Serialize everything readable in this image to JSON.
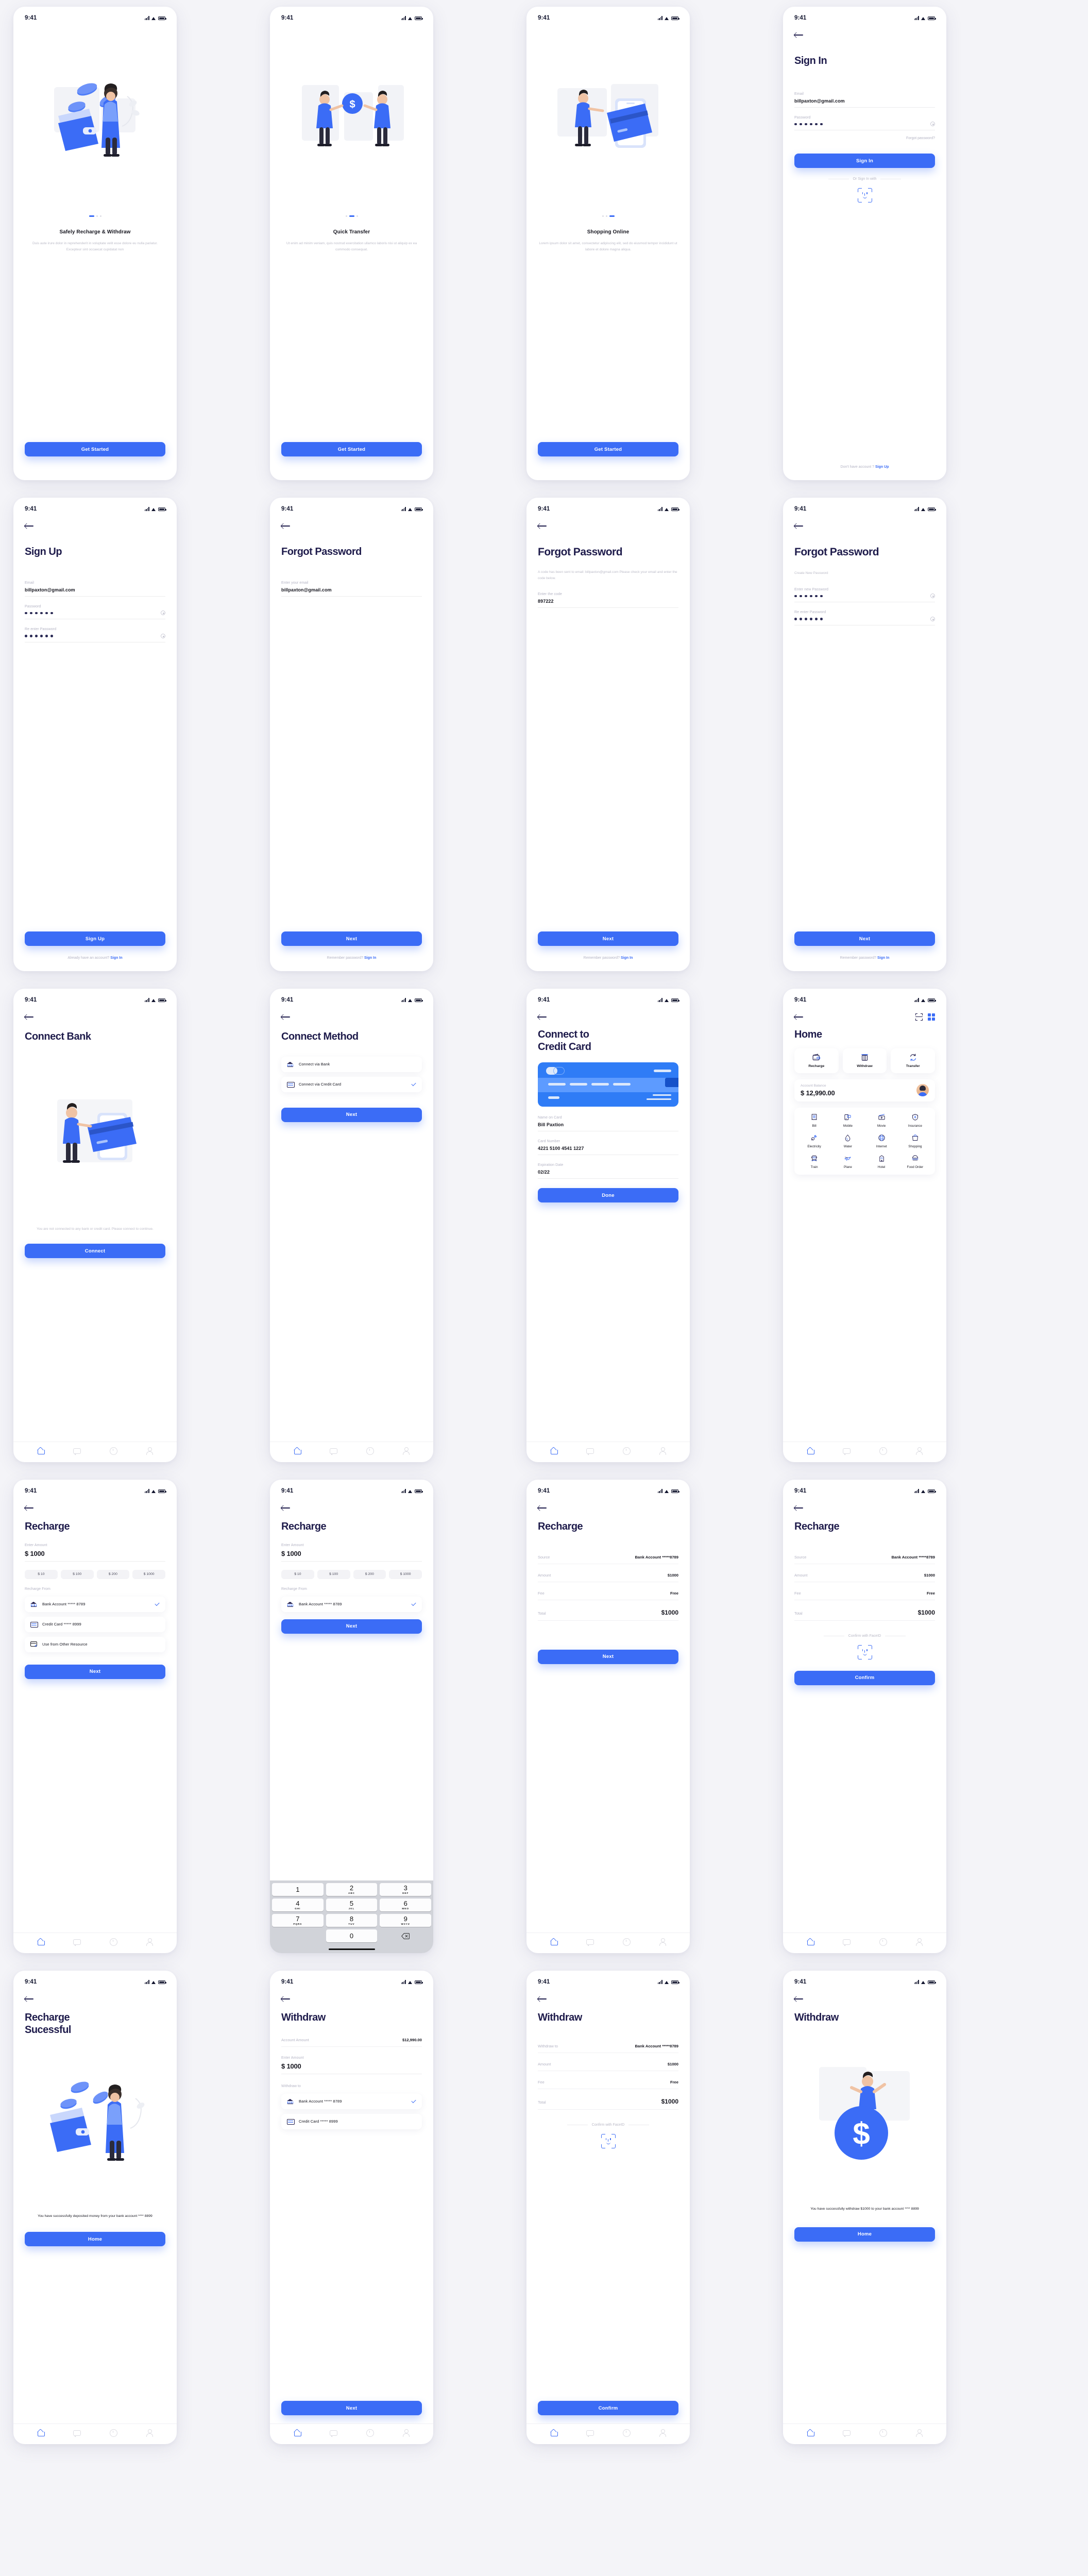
{
  "status_bar": {
    "time": "9:41"
  },
  "colors": {
    "primary": "#3b6cf6",
    "ink": "#1e1b4b",
    "muted": "#b4b4c4",
    "bg": "#f4f4f8"
  },
  "screens": {
    "onboard1": {
      "title": "Safely Recharge & Withdraw",
      "desc": "Duis aute irure dolor in reprehenderit in voluptate velit esse dolore eu nulla pariatur. Excepteur sint occaecat cupidatat non",
      "cta": "Get Started"
    },
    "onboard2": {
      "title": "Quick Transfer",
      "desc": "Ut enim ad minim veniam, quis nostrud exercitation ullamco laboris nisi ut aliquip ex ea commodo consequat.",
      "cta": "Get Started"
    },
    "onboard3": {
      "title": "Shopping Online",
      "desc": "Lorem ipsum dolor sit amet, consectetur adipiscing elit, sed do eiusmod tempor incididunt ut labore et dolore magna aliqua.",
      "cta": "Get Started"
    },
    "signin": {
      "title": "Sign In",
      "email_label": "Email",
      "email_value": "billpaxton@gmail.com",
      "password_label": "Password",
      "password_dots": 6,
      "forgot": "Forgot password?",
      "cta": "Sign In",
      "divider": "Or Sign In with",
      "faceid": "faceid-icon",
      "footer_text": "Don't have account ?",
      "footer_link": "Sign Up"
    },
    "signup": {
      "title": "Sign Up",
      "email_label": "Email",
      "email_value": "billpaxton@gmail.com",
      "password_label": "Password",
      "password_dots": 6,
      "repassword_label": "Re enter Password",
      "repassword_dots": 6,
      "cta": "Sign Up",
      "footer_text": "Already have an account?",
      "footer_link": "Sign In"
    },
    "forgot1": {
      "title": "Forgot Password",
      "email_label": "Enter your email",
      "email_value": "billpaxton@gmail.com",
      "cta": "Next",
      "footer_text": "Remember password?",
      "footer_link": "Sign In"
    },
    "forgot2": {
      "title": "Forgot Password",
      "desc": "A code has been sent to email: billpaxton@gmail.com Please check your email and enter the code below.",
      "code_label": "Enter the code",
      "code_value": "897222",
      "cta": "Next",
      "footer_text": "Remember password?",
      "footer_link": "Sign In"
    },
    "forgot3": {
      "title": "Forgot Password",
      "desc": "Create New Password",
      "new_label": "Enter new Password",
      "new_dots": 6,
      "re_label": "Re enter Password",
      "re_dots": 6,
      "cta": "Next",
      "footer_text": "Remember password?",
      "footer_link": "Sign In"
    },
    "connect_bank": {
      "title": "Connect Bank",
      "desc": "You are not connected to any bank or credit card. Please connect to continue.",
      "cta": "Connect"
    },
    "connect_method": {
      "title": "Connect Method",
      "options": [
        {
          "label": "Connect via Bank",
          "icon": "bank-icon",
          "checked": false
        },
        {
          "label": "Connect via Credit Card",
          "icon": "card-icon",
          "checked": true
        }
      ],
      "cta": "Next"
    },
    "connect_card": {
      "title": "Connect to Credit Card",
      "name_label": "Name on Card",
      "name_value": "Bill Paxtion",
      "number_label": "Card Number",
      "number_value": "4221 5100 4541 1227",
      "exp_label": "Expiration Date",
      "exp_value": "02/22",
      "cta": "Done"
    },
    "home": {
      "title": "Home",
      "quick_actions": [
        {
          "label": "Recharge",
          "icon": "wallet-icon"
        },
        {
          "label": "Withdraw",
          "icon": "atm-icon"
        },
        {
          "label": "Transfer",
          "icon": "transfer-icon"
        }
      ],
      "balance_label": "Account Balance",
      "balance_value": "$ 12,990.00",
      "services": [
        {
          "label": "Bill",
          "icon": "receipt-icon"
        },
        {
          "label": "Mobile",
          "icon": "mobile-icon"
        },
        {
          "label": "Movie",
          "icon": "movie-icon"
        },
        {
          "label": "Insurance",
          "icon": "insurance-icon"
        },
        {
          "label": "Electricity",
          "icon": "plug-icon"
        },
        {
          "label": "Water",
          "icon": "drop-icon"
        },
        {
          "label": "Internet",
          "icon": "globe-icon"
        },
        {
          "label": "Shopping",
          "icon": "bag-icon"
        },
        {
          "label": "Train",
          "icon": "train-icon"
        },
        {
          "label": "Plane",
          "icon": "plane-icon"
        },
        {
          "label": "Hotel",
          "icon": "hotel-icon"
        },
        {
          "label": "Food Order",
          "icon": "food-icon"
        }
      ]
    },
    "recharge1": {
      "title": "Recharge",
      "amount_label": "Enter Amount",
      "amount_value": "$ 1000",
      "chips": [
        "$ 10",
        "$ 100",
        "$ 200",
        "$ 1000"
      ],
      "source_label": "Recharge From",
      "sources": [
        {
          "label": "Bank Account ***** 8789",
          "icon": "bank-icon",
          "checked": true
        },
        {
          "label": "Credit Card ***** 8999",
          "icon": "card-icon",
          "checked": false
        },
        {
          "label": "Use from Other Resource",
          "icon": "add-card-icon",
          "checked": false
        }
      ],
      "cta": "Next"
    },
    "recharge2": {
      "title": "Recharge",
      "amount_label": "Enter Amount",
      "amount_value": "$ 1000",
      "chips": [
        "$ 10",
        "$ 100",
        "$ 200",
        "$ 1000"
      ],
      "source_label": "Recharge From",
      "sources": [
        {
          "label": "Bank Account ***** 8789",
          "icon": "bank-icon",
          "checked": true
        }
      ],
      "cta": "Next",
      "keypad": [
        {
          "num": "1",
          "sub": ""
        },
        {
          "num": "2",
          "sub": "ABC"
        },
        {
          "num": "3",
          "sub": "DEF"
        },
        {
          "num": "4",
          "sub": "GHI"
        },
        {
          "num": "5",
          "sub": "JKL"
        },
        {
          "num": "6",
          "sub": "MNO"
        },
        {
          "num": "7",
          "sub": "PQRS"
        },
        {
          "num": "8",
          "sub": "TUV"
        },
        {
          "num": "9",
          "sub": "WXYZ"
        },
        {
          "num": "0",
          "sub": ""
        }
      ]
    },
    "recharge3": {
      "title": "Recharge",
      "rows": [
        {
          "k": "Source",
          "v": "Bank Account *****8789",
          "big": false
        },
        {
          "k": "Amount",
          "v": "$1000",
          "big": false
        },
        {
          "k": "Fee",
          "v": "Free",
          "big": false
        },
        {
          "k": "Total",
          "v": "$1000",
          "big": true
        }
      ],
      "cta": "Next"
    },
    "recharge4": {
      "title": "Recharge",
      "rows": [
        {
          "k": "Source",
          "v": "Bank Account *****8789",
          "big": false
        },
        {
          "k": "Amount",
          "v": "$1000",
          "big": false
        },
        {
          "k": "Fee",
          "v": "Free",
          "big": false
        },
        {
          "k": "Total",
          "v": "$1000",
          "big": true
        }
      ],
      "divider": "Confirm with FaceID",
      "cta": "Confirm"
    },
    "recharge_success": {
      "title": "Recharge Sucessful",
      "desc": "You have successfully deposited money from your bank account **** 8899",
      "cta": "Home"
    },
    "withdraw1": {
      "title": "Withdraw",
      "account_label": "Account Amount",
      "account_value": "$12,990.00",
      "amount_label": "Enter Amount",
      "amount_value": "$ 1000",
      "dest_label": "Withdraw to",
      "destinations": [
        {
          "label": "Bank Account ***** 8789",
          "icon": "bank-icon",
          "checked": true
        },
        {
          "label": "Credit Card ***** 8999",
          "icon": "card-icon",
          "checked": false
        }
      ],
      "cta": "Next"
    },
    "withdraw2": {
      "title": "Withdraw",
      "rows": [
        {
          "k": "Withdraw to",
          "v": "Bank Account *****8789",
          "big": false
        },
        {
          "k": "Amount",
          "v": "$1000",
          "big": false
        },
        {
          "k": "Fee",
          "v": "Free",
          "big": false
        },
        {
          "k": "Total",
          "v": "$1000",
          "big": true
        }
      ],
      "divider": "Confirm with FaceID",
      "cta": "Confirm"
    },
    "withdraw_success": {
      "title": "Withdraw",
      "desc": "You have successfully withdraw $1000 to your bank account **** 8899",
      "cta": "Home"
    }
  },
  "nav": {
    "items": [
      "home",
      "chat",
      "history",
      "profile"
    ]
  }
}
